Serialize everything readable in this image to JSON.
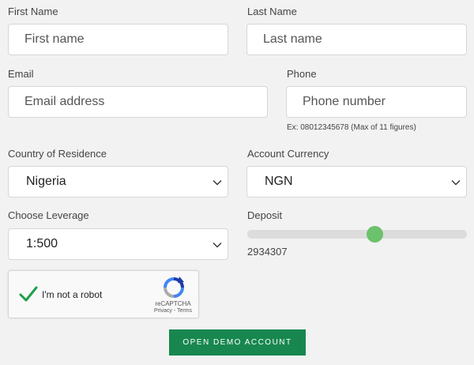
{
  "form": {
    "first_name": {
      "label": "First Name",
      "placeholder": "First name"
    },
    "last_name": {
      "label": "Last Name",
      "placeholder": "Last name"
    },
    "email": {
      "label": "Email",
      "placeholder": "Email address"
    },
    "phone": {
      "label": "Phone",
      "placeholder": "Phone number",
      "hint": "Ex: 08012345678 (Max of 11 figures)"
    },
    "country": {
      "label": "Country of Residence",
      "value": "Nigeria"
    },
    "currency": {
      "label": "Account Currency",
      "value": "NGN"
    },
    "leverage": {
      "label": "Choose Leverage",
      "value": "1:500"
    },
    "deposit": {
      "label": "Deposit",
      "value": "2934307",
      "slider_fraction": 0.58
    }
  },
  "captcha": {
    "text": "I'm not a robot",
    "brand": "reCAPTCHA",
    "terms": "Privacy - Terms",
    "checked": true
  },
  "submit_label": "OPEN DEMO ACCOUNT",
  "colors": {
    "accent": "#17874f",
    "slider_thumb": "#6cc26c",
    "check": "#1e9e4a",
    "background": "#f2f2f2"
  }
}
